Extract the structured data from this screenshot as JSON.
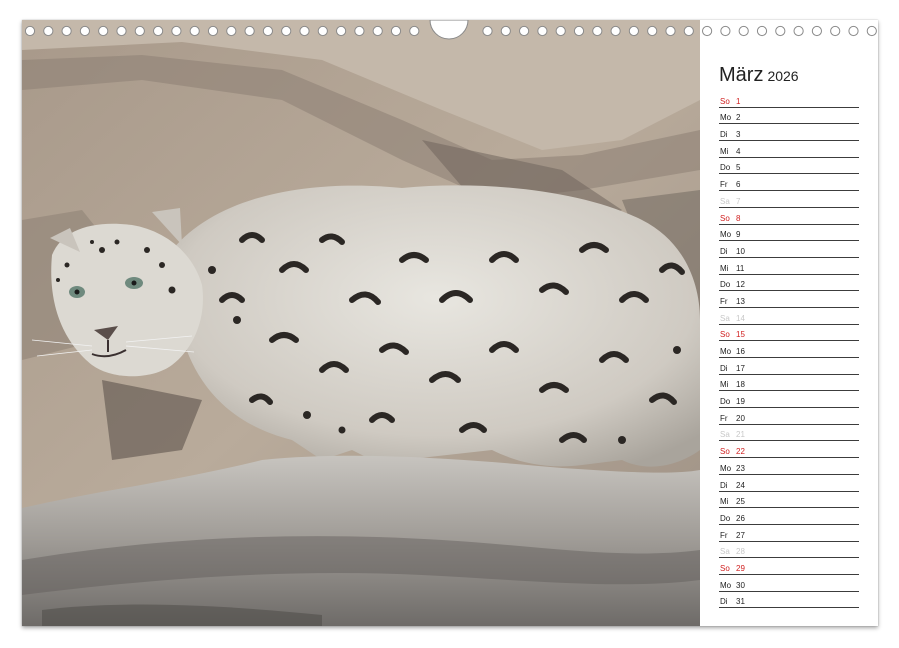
{
  "calendar": {
    "month": "März",
    "year": "2026",
    "days": [
      {
        "wd": "So",
        "num": "1",
        "type": "sun"
      },
      {
        "wd": "Mo",
        "num": "2",
        "type": "week"
      },
      {
        "wd": "Di",
        "num": "3",
        "type": "week"
      },
      {
        "wd": "Mi",
        "num": "4",
        "type": "week"
      },
      {
        "wd": "Do",
        "num": "5",
        "type": "week"
      },
      {
        "wd": "Fr",
        "num": "6",
        "type": "week"
      },
      {
        "wd": "Sa",
        "num": "7",
        "type": "sat"
      },
      {
        "wd": "So",
        "num": "8",
        "type": "sun"
      },
      {
        "wd": "Mo",
        "num": "9",
        "type": "week"
      },
      {
        "wd": "Di",
        "num": "10",
        "type": "week"
      },
      {
        "wd": "Mi",
        "num": "11",
        "type": "week"
      },
      {
        "wd": "Do",
        "num": "12",
        "type": "week"
      },
      {
        "wd": "Fr",
        "num": "13",
        "type": "week"
      },
      {
        "wd": "Sa",
        "num": "14",
        "type": "sat"
      },
      {
        "wd": "So",
        "num": "15",
        "type": "sun"
      },
      {
        "wd": "Mo",
        "num": "16",
        "type": "week"
      },
      {
        "wd": "Di",
        "num": "17",
        "type": "week"
      },
      {
        "wd": "Mi",
        "num": "18",
        "type": "week"
      },
      {
        "wd": "Do",
        "num": "19",
        "type": "week"
      },
      {
        "wd": "Fr",
        "num": "20",
        "type": "week"
      },
      {
        "wd": "Sa",
        "num": "21",
        "type": "sat"
      },
      {
        "wd": "So",
        "num": "22",
        "type": "sun"
      },
      {
        "wd": "Mo",
        "num": "23",
        "type": "week"
      },
      {
        "wd": "Di",
        "num": "24",
        "type": "week"
      },
      {
        "wd": "Mi",
        "num": "25",
        "type": "week"
      },
      {
        "wd": "Do",
        "num": "26",
        "type": "week"
      },
      {
        "wd": "Fr",
        "num": "27",
        "type": "week"
      },
      {
        "wd": "Sa",
        "num": "28",
        "type": "sat"
      },
      {
        "wd": "So",
        "num": "29",
        "type": "sun"
      },
      {
        "wd": "Mo",
        "num": "30",
        "type": "week"
      },
      {
        "wd": "Di",
        "num": "31",
        "type": "week"
      }
    ]
  },
  "colors": {
    "sunday": "#d02020",
    "saturday": "#c8c8c8",
    "text": "#222222",
    "line": "#3c3c3c"
  },
  "photo": {
    "subject": "snow-leopard"
  }
}
